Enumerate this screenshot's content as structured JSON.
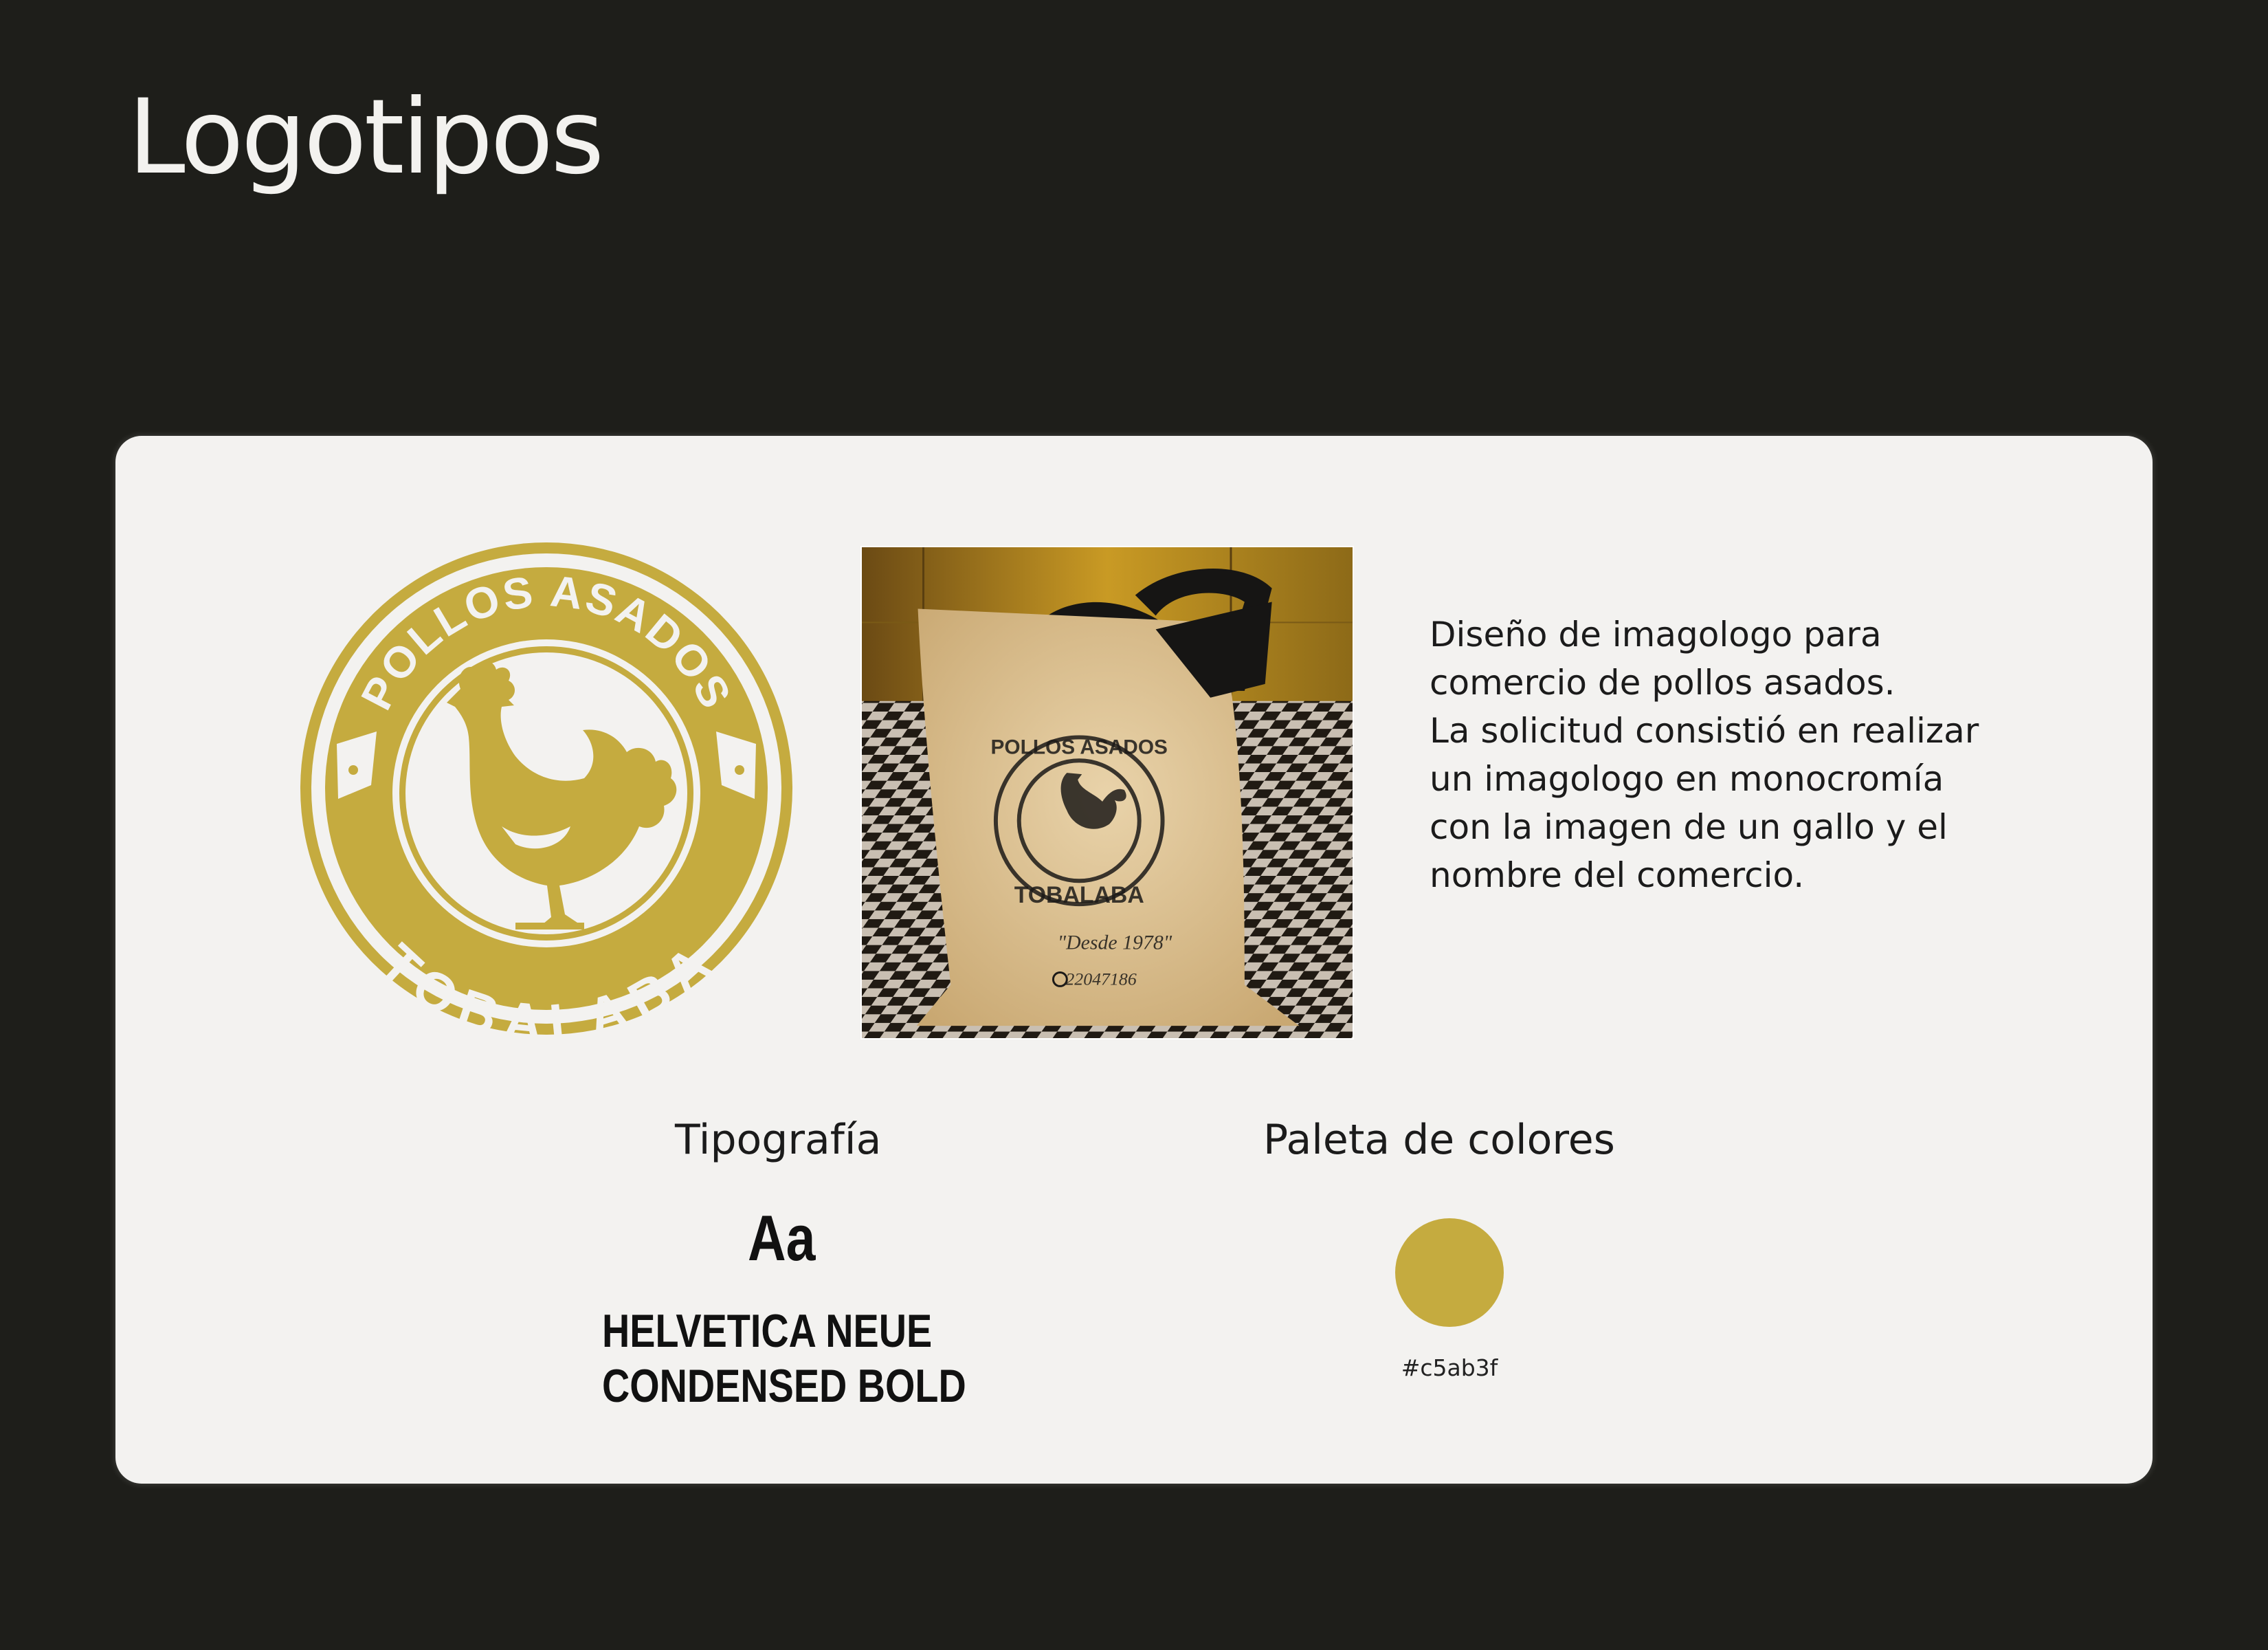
{
  "page": {
    "title": "Logotipos"
  },
  "emblem": {
    "top_text": "POLLOS ASADOS",
    "bottom_text": "TOBALABA",
    "icon": "rooster-icon",
    "color": "#c5ab3f"
  },
  "photo": {
    "subject": "tote-bag-icon",
    "stamp_top": "POLLOS ASADOS",
    "stamp_bottom": "TOBALABA",
    "tagline": "\"Desde 1978\"",
    "phone": "22047186"
  },
  "description": {
    "lines": [
      "Diseño de imagologo para",
      "comercio de pollos asados.",
      "La solicitud consistió en realizar",
      "un imagologo en monocromía",
      "con la imagen de un gallo y el",
      "nombre del comercio."
    ]
  },
  "typography": {
    "heading": "Tipografía",
    "sample": "Aa",
    "font_name_lines": [
      "HELVETICA NEUE",
      "CONDENSED BOLD"
    ]
  },
  "palette": {
    "heading": "Paleta de colores",
    "colors": [
      {
        "hex": "#c5ab3f",
        "label": "#c5ab3f"
      }
    ]
  }
}
